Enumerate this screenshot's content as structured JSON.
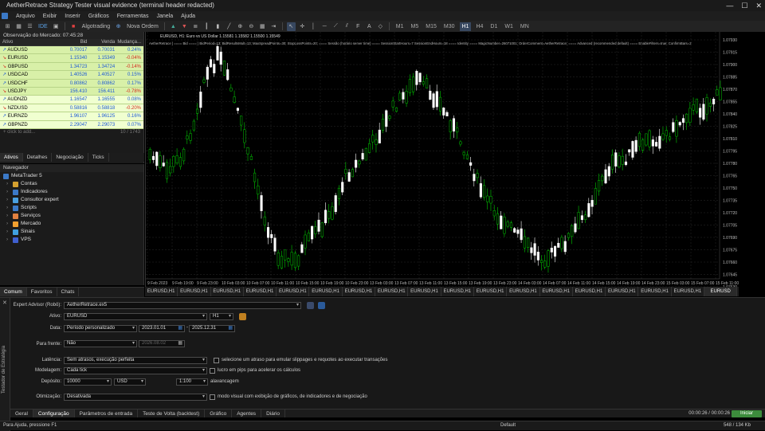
{
  "titlebar": {
    "title": "AetherRetrace Strategy Tester visual evidence (terminal header redacted)",
    "min": "—",
    "max": "☐",
    "close": "✕"
  },
  "menu": [
    "Arquivo",
    "Exibir",
    "Inserir",
    "Gráficos",
    "Ferramentas",
    "Janela",
    "Ajuda"
  ],
  "toolbar": {
    "algotrading": "Algotrading",
    "new_order": "Nova Ordem",
    "ide": "IDE",
    "timeframes": [
      "M1",
      "M5",
      "M15",
      "M30",
      "H1",
      "H4",
      "D1",
      "W1",
      "MN"
    ],
    "active_tf": "H1"
  },
  "market_watch": {
    "title": "Observação do Mercado: 07:45:28",
    "headers": {
      "symbol": "Ativo",
      "bid": "Bid",
      "ask": "Venda",
      "change": "Mudança..."
    },
    "rows": [
      {
        "symbol": "AUDUSD",
        "bid": "0.70017",
        "ask": "0.70031",
        "change": "0.24%"
      },
      {
        "symbol": "EURUSD",
        "bid": "1.15340",
        "ask": "1.15349",
        "change": "-0.04%"
      },
      {
        "symbol": "GBPUSD",
        "bid": "1.34723",
        "ask": "1.34724",
        "change": "-0.14%"
      },
      {
        "symbol": "USDCAD",
        "bid": "1.40526",
        "ask": "1.40527",
        "change": "0.15%"
      },
      {
        "symbol": "USDCHF",
        "bid": "0.80862",
        "ask": "0.80862",
        "change": "0.17%"
      },
      {
        "symbol": "USDJPY",
        "bid": "156.410",
        "ask": "156.411",
        "change": "-0.78%"
      },
      {
        "symbol": "AUDNZD",
        "bid": "1.16547",
        "ask": "1.16555",
        "change": "0.08%"
      },
      {
        "symbol": "NZDUSD",
        "bid": "0.58816",
        "ask": "0.58818",
        "change": "-0.20%"
      },
      {
        "symbol": "EURNZD",
        "bid": "1.96107",
        "ask": "1.96125",
        "change": "0.16%"
      },
      {
        "symbol": "GBPNZD",
        "bid": "2.29047",
        "ask": "2.29073",
        "change": "0.07%"
      }
    ],
    "add": "+ click to add...",
    "count": "10 / 1743",
    "tabs": [
      "Ativos",
      "Detalhes",
      "Negociação",
      "Ticks"
    ]
  },
  "navigator": {
    "title": "Navegador",
    "root": "MetaTrader 5",
    "items": [
      "Contas",
      "Indicadores",
      "Consultor expert",
      "Scripts",
      "Serviços",
      "Mercado",
      "Sinais",
      "VPS"
    ],
    "tabs": [
      "Comum",
      "Favoritos",
      "Chats"
    ]
  },
  "chart": {
    "title": "EURUSD, H1:  Euro vs US Dollar  1.15581 1.15582 1.15500 1.15549",
    "info": "AetherRetrace | ==== Bid ==== | BidPeriod=13; BidResultsMult=13; MaxSpreadPoints=30; StopLossPoints=20; ==== Sessão (horário server time) ==== SessionStartHours=7 SessionEndHours=18 ==== Identity ==== MagicNumber=26071001; OrderComment=AetherRetrace; ==== Advanced (recommended default) ==== EnableFilters=true; ConfirmBars=2",
    "price_labels": [
      "1.07930",
      "1.07915",
      "1.07900",
      "1.07885",
      "1.07870",
      "1.07855",
      "1.07840",
      "1.07825",
      "1.07810",
      "1.07795",
      "1.07780",
      "1.07765",
      "1.07750",
      "1.07735",
      "1.07720",
      "1.07705",
      "1.07690",
      "1.07675",
      "1.07660",
      "1.07645",
      "1.07630"
    ],
    "time_labels": [
      "9 Feb 2023",
      "9 Feb 19:00",
      "9 Feb 23:00",
      "10 Feb 03:00",
      "10 Feb 07:00",
      "10 Feb 11:00",
      "10 Feb 15:00",
      "10 Feb 19:00",
      "10 Feb 23:00",
      "13 Feb 03:00",
      "13 Feb 07:00",
      "13 Feb 11:00",
      "13 Feb 15:00",
      "13 Feb 19:00",
      "13 Feb 23:00",
      "14 Feb 03:00",
      "14 Feb 07:00",
      "14 Feb 11:00",
      "14 Feb 15:00",
      "14 Feb 19:00",
      "14 Feb 23:00",
      "15 Feb 03:00",
      "15 Feb 07:00",
      "15 Feb 11:00"
    ],
    "tabs": [
      "EURUSD,H1",
      "EURUSD,H1",
      "EURUSD,H1",
      "EURUSD,H1",
      "EURUSD,H1",
      "EURUSD,H1",
      "EURUSD,H1",
      "EURUSD,H1",
      "EURUSD,H1",
      "EURUSD,H1",
      "EURUSD,H1",
      "EURUSD,H1",
      "EURUSD,H1",
      "EURUSD,H1",
      "EURUSD,H1",
      "EURUSD,H1",
      "EURUSD,H1",
      "EURUSD"
    ],
    "colors": {
      "bull": "#ffffff",
      "bear": "#00c800",
      "grid": "#2a2a2a"
    }
  },
  "strategy_tester": {
    "side_label": "Testador de Estratégia",
    "expert_label": "Expert Advisor (Robô):",
    "expert_value": "AetherRetrace.ex5",
    "symbol_label": "Ativo:",
    "symbol_value": "EURUSD",
    "period_value": "H1",
    "date_label": "Data:",
    "date_mode": "Período personalizado",
    "date_from": "2023.01.01",
    "date_to": "2025.12.31",
    "forward_label": "Para frente:",
    "forward_value": "Não",
    "forward_date": "2026.08.02",
    "latency_label": "Latência:",
    "latency_value": "Sem atrasos, execução perfeita",
    "latency_hint": "selecione um atraso para emular slippages e requotes ao executar transações",
    "model_label": "Modelagem:",
    "model_value": "Cada tick",
    "profit_pips": "lucro em pips para acelerar os cálculos",
    "deposit_label": "Depósito:",
    "deposit_value": "10000",
    "currency": "USD",
    "leverage": "1:100",
    "leverage_label": "alavancagem",
    "opt_label": "Otimização:",
    "opt_value": "Desativada",
    "visual_mode": "modo visual com exibição de gráficos, de indicadores e de negociação",
    "tabs": [
      "Geral",
      "Configuração",
      "Parâmetros de entrada",
      "Teste de Volta (backtest)",
      "Gráfico",
      "Agentes",
      "Diário"
    ],
    "timer": "00:00:26 / 00:00:26",
    "start": "Iniciar"
  },
  "status": {
    "left": "Para Ajuda, pressione F1",
    "mid": "Default",
    "right": "548 / 134 Kb"
  }
}
